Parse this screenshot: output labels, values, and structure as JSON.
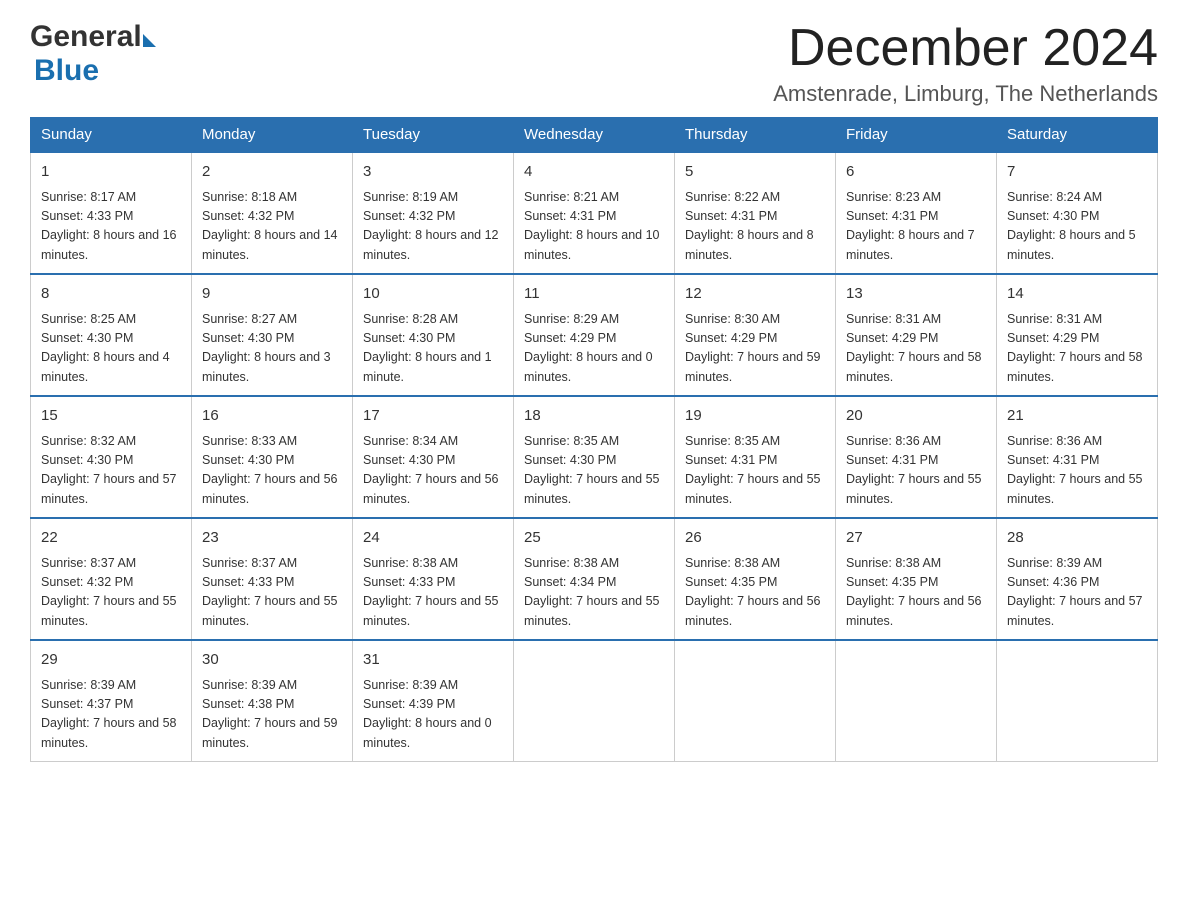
{
  "logo": {
    "general": "General",
    "blue": "Blue"
  },
  "title": "December 2024",
  "location": "Amstenrade, Limburg, The Netherlands",
  "days_header": [
    "Sunday",
    "Monday",
    "Tuesday",
    "Wednesday",
    "Thursday",
    "Friday",
    "Saturday"
  ],
  "weeks": [
    [
      {
        "day": "1",
        "sunrise": "8:17 AM",
        "sunset": "4:33 PM",
        "daylight": "8 hours and 16 minutes."
      },
      {
        "day": "2",
        "sunrise": "8:18 AM",
        "sunset": "4:32 PM",
        "daylight": "8 hours and 14 minutes."
      },
      {
        "day": "3",
        "sunrise": "8:19 AM",
        "sunset": "4:32 PM",
        "daylight": "8 hours and 12 minutes."
      },
      {
        "day": "4",
        "sunrise": "8:21 AM",
        "sunset": "4:31 PM",
        "daylight": "8 hours and 10 minutes."
      },
      {
        "day": "5",
        "sunrise": "8:22 AM",
        "sunset": "4:31 PM",
        "daylight": "8 hours and 8 minutes."
      },
      {
        "day": "6",
        "sunrise": "8:23 AM",
        "sunset": "4:31 PM",
        "daylight": "8 hours and 7 minutes."
      },
      {
        "day": "7",
        "sunrise": "8:24 AM",
        "sunset": "4:30 PM",
        "daylight": "8 hours and 5 minutes."
      }
    ],
    [
      {
        "day": "8",
        "sunrise": "8:25 AM",
        "sunset": "4:30 PM",
        "daylight": "8 hours and 4 minutes."
      },
      {
        "day": "9",
        "sunrise": "8:27 AM",
        "sunset": "4:30 PM",
        "daylight": "8 hours and 3 minutes."
      },
      {
        "day": "10",
        "sunrise": "8:28 AM",
        "sunset": "4:30 PM",
        "daylight": "8 hours and 1 minute."
      },
      {
        "day": "11",
        "sunrise": "8:29 AM",
        "sunset": "4:29 PM",
        "daylight": "8 hours and 0 minutes."
      },
      {
        "day": "12",
        "sunrise": "8:30 AM",
        "sunset": "4:29 PM",
        "daylight": "7 hours and 59 minutes."
      },
      {
        "day": "13",
        "sunrise": "8:31 AM",
        "sunset": "4:29 PM",
        "daylight": "7 hours and 58 minutes."
      },
      {
        "day": "14",
        "sunrise": "8:31 AM",
        "sunset": "4:29 PM",
        "daylight": "7 hours and 58 minutes."
      }
    ],
    [
      {
        "day": "15",
        "sunrise": "8:32 AM",
        "sunset": "4:30 PM",
        "daylight": "7 hours and 57 minutes."
      },
      {
        "day": "16",
        "sunrise": "8:33 AM",
        "sunset": "4:30 PM",
        "daylight": "7 hours and 56 minutes."
      },
      {
        "day": "17",
        "sunrise": "8:34 AM",
        "sunset": "4:30 PM",
        "daylight": "7 hours and 56 minutes."
      },
      {
        "day": "18",
        "sunrise": "8:35 AM",
        "sunset": "4:30 PM",
        "daylight": "7 hours and 55 minutes."
      },
      {
        "day": "19",
        "sunrise": "8:35 AM",
        "sunset": "4:31 PM",
        "daylight": "7 hours and 55 minutes."
      },
      {
        "day": "20",
        "sunrise": "8:36 AM",
        "sunset": "4:31 PM",
        "daylight": "7 hours and 55 minutes."
      },
      {
        "day": "21",
        "sunrise": "8:36 AM",
        "sunset": "4:31 PM",
        "daylight": "7 hours and 55 minutes."
      }
    ],
    [
      {
        "day": "22",
        "sunrise": "8:37 AM",
        "sunset": "4:32 PM",
        "daylight": "7 hours and 55 minutes."
      },
      {
        "day": "23",
        "sunrise": "8:37 AM",
        "sunset": "4:33 PM",
        "daylight": "7 hours and 55 minutes."
      },
      {
        "day": "24",
        "sunrise": "8:38 AM",
        "sunset": "4:33 PM",
        "daylight": "7 hours and 55 minutes."
      },
      {
        "day": "25",
        "sunrise": "8:38 AM",
        "sunset": "4:34 PM",
        "daylight": "7 hours and 55 minutes."
      },
      {
        "day": "26",
        "sunrise": "8:38 AM",
        "sunset": "4:35 PM",
        "daylight": "7 hours and 56 minutes."
      },
      {
        "day": "27",
        "sunrise": "8:38 AM",
        "sunset": "4:35 PM",
        "daylight": "7 hours and 56 minutes."
      },
      {
        "day": "28",
        "sunrise": "8:39 AM",
        "sunset": "4:36 PM",
        "daylight": "7 hours and 57 minutes."
      }
    ],
    [
      {
        "day": "29",
        "sunrise": "8:39 AM",
        "sunset": "4:37 PM",
        "daylight": "7 hours and 58 minutes."
      },
      {
        "day": "30",
        "sunrise": "8:39 AM",
        "sunset": "4:38 PM",
        "daylight": "7 hours and 59 minutes."
      },
      {
        "day": "31",
        "sunrise": "8:39 AM",
        "sunset": "4:39 PM",
        "daylight": "8 hours and 0 minutes."
      },
      null,
      null,
      null,
      null
    ]
  ]
}
